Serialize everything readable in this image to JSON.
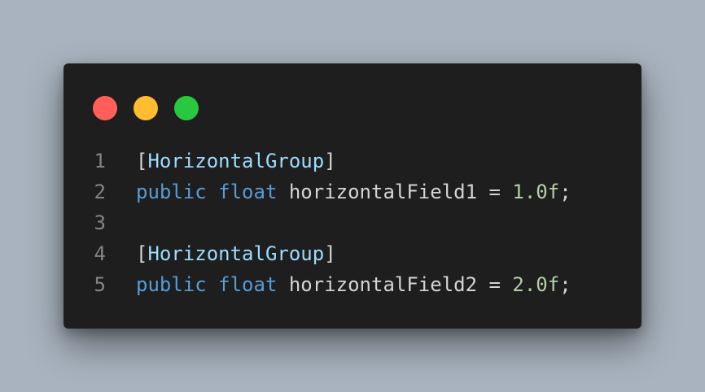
{
  "colors": {
    "background": "#a8b3bf",
    "editor_background": "#1e1e1e",
    "close_dot": "#ff5f57",
    "minimize_dot": "#febc2e",
    "maximize_dot": "#28c840",
    "line_number": "#858585",
    "keyword": "#569cd6",
    "attribute": "#9cdcfe",
    "number": "#b5cea8",
    "text": "#d4d4d4"
  },
  "code": {
    "lines": [
      {
        "number": "1",
        "tokens": [
          {
            "type": "punct",
            "text": "["
          },
          {
            "type": "attr",
            "text": "HorizontalGroup"
          },
          {
            "type": "punct",
            "text": "]"
          }
        ]
      },
      {
        "number": "2",
        "tokens": [
          {
            "type": "kw",
            "text": "public"
          },
          {
            "type": "ident",
            "text": " "
          },
          {
            "type": "kw",
            "text": "float"
          },
          {
            "type": "ident",
            "text": " horizontalField1 = "
          },
          {
            "type": "num",
            "text": "1.0f"
          },
          {
            "type": "punct",
            "text": ";"
          }
        ]
      },
      {
        "number": "3",
        "tokens": []
      },
      {
        "number": "4",
        "tokens": [
          {
            "type": "punct",
            "text": "["
          },
          {
            "type": "attr",
            "text": "HorizontalGroup"
          },
          {
            "type": "punct",
            "text": "]"
          }
        ]
      },
      {
        "number": "5",
        "tokens": [
          {
            "type": "kw",
            "text": "public"
          },
          {
            "type": "ident",
            "text": " "
          },
          {
            "type": "kw",
            "text": "float"
          },
          {
            "type": "ident",
            "text": " horizontalField2 = "
          },
          {
            "type": "num",
            "text": "2.0f"
          },
          {
            "type": "punct",
            "text": ";"
          }
        ]
      }
    ]
  }
}
